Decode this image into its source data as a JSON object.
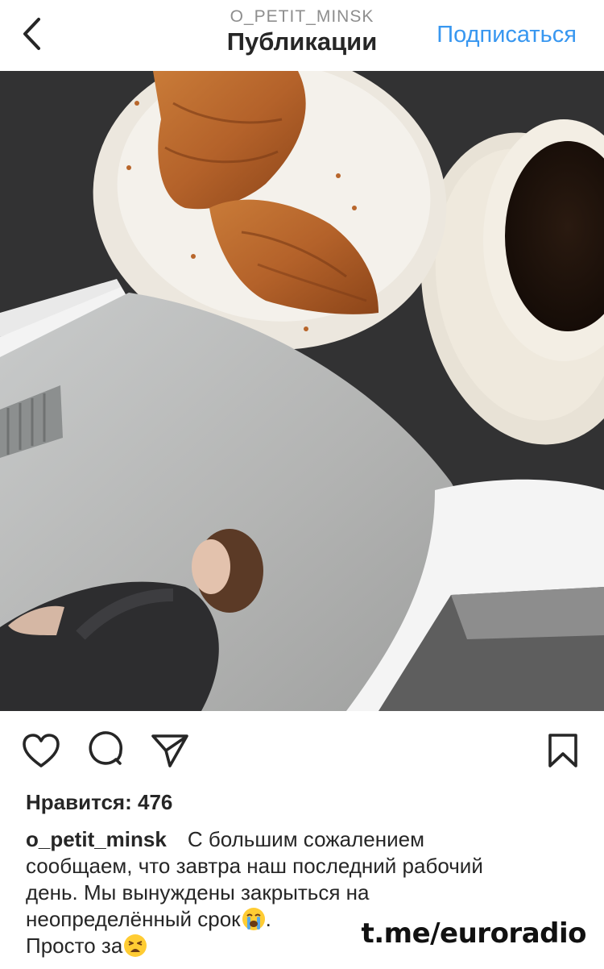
{
  "header": {
    "username": "O_PETIT_MINSK",
    "title": "Публикации",
    "follow_label": "Подписаться"
  },
  "icons": {
    "back": "chevron-left-icon",
    "like": "heart-icon",
    "comment": "comment-icon",
    "share": "paper-plane-icon",
    "save": "bookmark-icon",
    "emoji_1": "loudly-crying-face-emoji",
    "emoji_2": "weary-face-emoji"
  },
  "post": {
    "likes_label": "Нравится:",
    "likes_count": "476",
    "author": "o_petit_minsk",
    "caption_line_1": "С большим сожалением",
    "caption_line_2": "сообщаем, что завтра наш последний рабочий",
    "caption_line_3": "день. Мы вынуждены закрыться на",
    "caption_line_4": "неопределённый срок",
    "caption_line_4_end": ".",
    "caption_line_5": "Просто за"
  },
  "watermark": "t.me/euroradio",
  "colors": {
    "link_blue": "#3897f0",
    "text": "#262626",
    "muted": "#8e8e8e"
  }
}
